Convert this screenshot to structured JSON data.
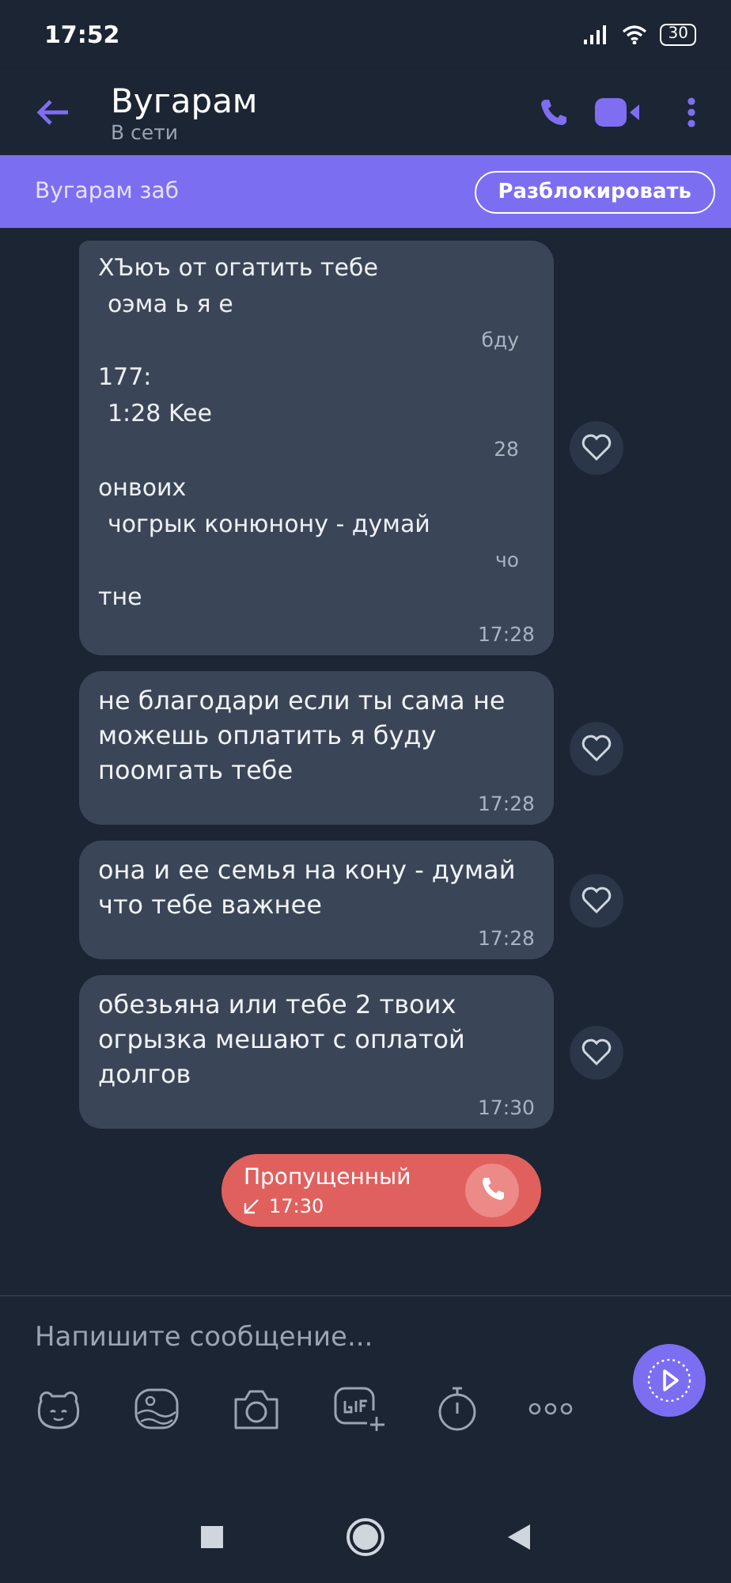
{
  "status_bar": {
    "time": "17:52",
    "battery": "30"
  },
  "header": {
    "title": "Вугарам",
    "subtitle": "В сети"
  },
  "banner": {
    "text": "Вугарам заб",
    "button": "Разблокировать"
  },
  "messages": [
    {
      "kind": "garbled",
      "lines": [
        "ХЪюъ от огатить тебе",
        "оэма ь я е",
        "бду",
        "177:",
        "1:28 Kee",
        "28",
        "онвоих",
        "чогрык конюнону - думай",
        "чо",
        "тне"
      ],
      "time": "17:28"
    },
    {
      "kind": "text",
      "text": "не благодари если ты сама не можешь оплатить я буду поомгать тебе",
      "time": "17:28"
    },
    {
      "kind": "text",
      "text": "она и ее семья на кону - думай что тебе важнее",
      "time": "17:28"
    },
    {
      "kind": "text",
      "text": "обезьяна или тебе 2 твоих огрызка мешают с оплатой долгов",
      "time": "17:30"
    }
  ],
  "missed_call": {
    "label": "Пропущенный",
    "time": "17:30"
  },
  "composer": {
    "placeholder": "Напишите сообщение..."
  }
}
